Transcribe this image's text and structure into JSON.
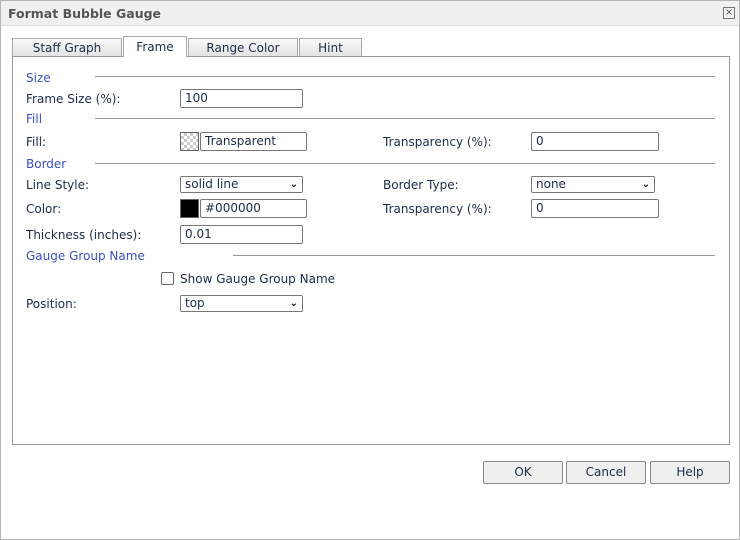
{
  "window": {
    "title": "Format Bubble Gauge",
    "close_icon": "close-icon"
  },
  "tabs": [
    {
      "label": "Staff Graph"
    },
    {
      "label": "Frame",
      "active": true
    },
    {
      "label": "Range Color"
    },
    {
      "label": "Hint"
    }
  ],
  "size": {
    "header": "Size",
    "frame_size_label": "Frame Size (%):",
    "frame_size_value": "100"
  },
  "fill": {
    "header": "Fill",
    "fill_label": "Fill:",
    "fill_value": "Transparent",
    "transparency_label": "Transparency (%):",
    "transparency_value": "0"
  },
  "border": {
    "header": "Border",
    "line_style_label": "Line Style:",
    "line_style_value": "solid line",
    "border_type_label": "Border Type:",
    "border_type_value": "none",
    "color_label": "Color:",
    "color_value": "#000000",
    "color_swatch": "#000000",
    "transparency_label": "Transparency (%):",
    "transparency_value": "0",
    "thickness_label": "Thickness (inches):",
    "thickness_value": "0.01"
  },
  "gauge_group": {
    "header": "Gauge Group Name",
    "show_label": "Show Gauge Group Name",
    "show_checked": false,
    "position_label": "Position:",
    "position_value": "top"
  },
  "buttons": {
    "ok": "OK",
    "cancel": "Cancel",
    "help": "Help"
  },
  "colors": {
    "section_header": "#3a4fc4",
    "text": "#1c2b4a"
  }
}
